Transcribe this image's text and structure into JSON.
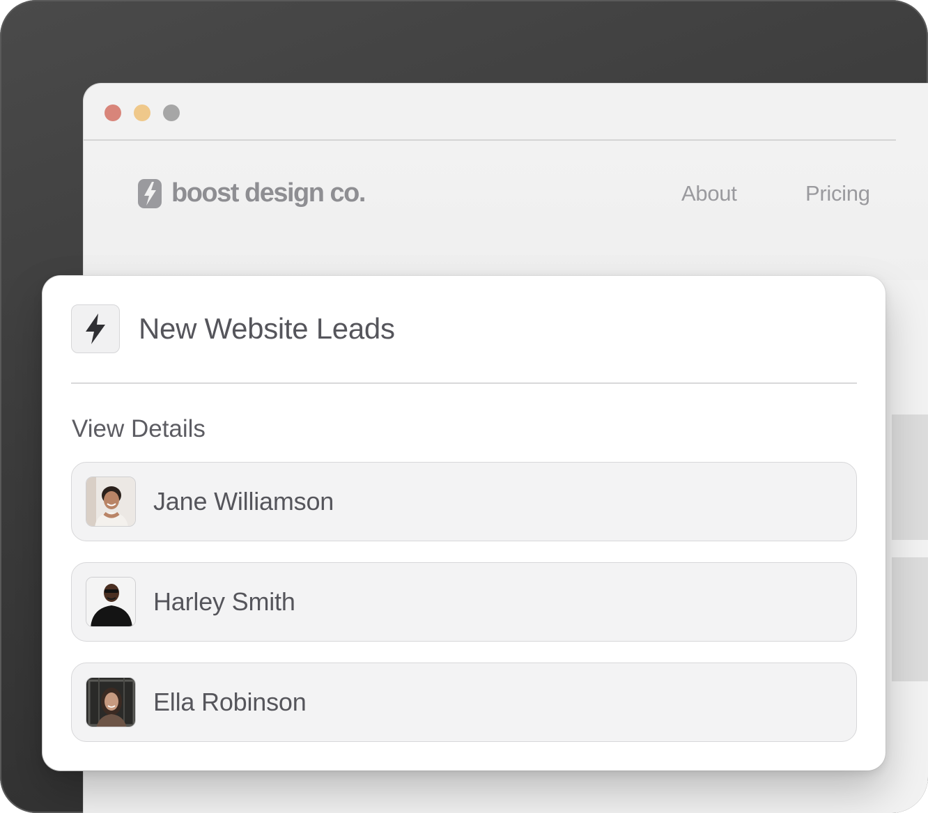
{
  "browser": {
    "traffic_lights": [
      "close",
      "minimize",
      "zoom"
    ],
    "colors": {
      "red": "#d8857a",
      "yellow": "#efc88a",
      "gray": "#a6a6a6"
    }
  },
  "site": {
    "brand_name": "boost design co.",
    "logo_icon": "bolt-logo-icon",
    "nav": {
      "about": "About",
      "pricing": "Pricing"
    }
  },
  "card": {
    "icon": "lightning-bolt-icon",
    "title": "New Website Leads",
    "section_label": "View Details",
    "leads": [
      {
        "name": "Jane Williamson",
        "avatar": "avatar-photo"
      },
      {
        "name": "Harley Smith",
        "avatar": "avatar-photo"
      },
      {
        "name": "Ella Robinson",
        "avatar": "avatar-photo"
      }
    ]
  }
}
